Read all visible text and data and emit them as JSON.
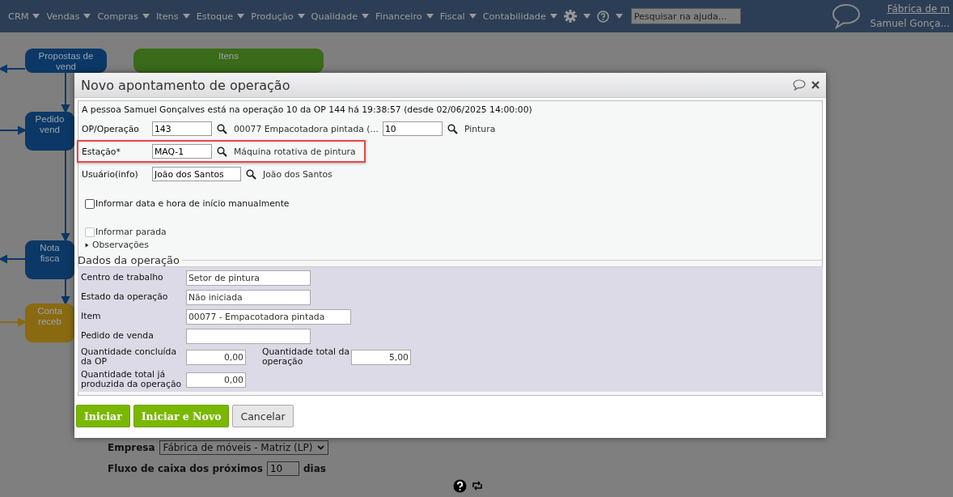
{
  "nav": {
    "menus": [
      "CRM",
      "Vendas",
      "Compras",
      "Itens",
      "Estoque",
      "Produção",
      "Qualidade",
      "Financeiro",
      "Fiscal",
      "Contabilidade"
    ],
    "search": {
      "placeholder": "Pesquisar na ajuda..."
    },
    "company_link": "Fábrica de m",
    "user": "Samuel Gonça..."
  },
  "flowchart": {
    "nodes": [
      {
        "lines": [
          "Propostas de",
          "vend"
        ],
        "color": "#0b3866"
      },
      {
        "lines": [
          "Itens"
        ],
        "color": "#3b6a1a"
      },
      {
        "lines": [
          "Pedido",
          "vend"
        ],
        "color": "#0b3866"
      },
      {
        "lines": [
          "Nota",
          "fisca"
        ],
        "color": "#0b3866"
      },
      {
        "lines": [
          "Conta",
          "receb"
        ],
        "color": "#8a6a10"
      }
    ]
  },
  "background_form": {
    "company_label": "Empresa",
    "company_select": "Fábrica de móveis - Matriz (LP)",
    "cashflow_label": "Fluxo de caixa dos próximos",
    "cashflow_days": "10",
    "days_unit": "dias"
  },
  "dialog": {
    "title": "Novo apontamento de operação",
    "info": "A pessoa Samuel Gonçalves está na operação 10 da OP 144 há 19:38:57 (desde 02/06/2025 14:00:00)",
    "fields": [
      {
        "label": "OP/Operação",
        "value": "143",
        "description": "00077 Empacotadora pintada (...",
        "second_value": "10",
        "second_description": "Pintura",
        "highlighted": false
      },
      {
        "label": "Estação*",
        "value": "MAQ-1",
        "description": "Máquina rotativa de pintura",
        "highlighted": true
      },
      {
        "label": "Usuário(info)",
        "value": "João dos Santos",
        "description": "João dos Santos",
        "highlighted": false
      }
    ],
    "checkboxes": [
      {
        "label": "Informar data e hora de início manualmente",
        "checked": false,
        "disabled": false
      },
      {
        "label": "Informar parada",
        "checked": false,
        "disabled": true
      }
    ],
    "expander": {
      "label": "Observações",
      "expanded": false
    },
    "section": {
      "title": "Dados da operação",
      "rows": [
        [
          {
            "label": "Centro de trabalho",
            "value": "Setor de pintura",
            "kind": "text"
          }
        ],
        [
          {
            "label": "Estado da operação",
            "value": "Não iniciada",
            "kind": "text"
          }
        ],
        [
          {
            "label": "Item",
            "value": "00077 - Empacotadora pintada",
            "kind": "wide"
          }
        ],
        [
          {
            "label": "Pedido de venda",
            "kind": "text"
          }
        ],
        [
          {
            "label": "Quantidade concluída da OP",
            "value": "0,00",
            "kind": "number"
          },
          {
            "label": "Quantidade total da operação",
            "value": "5,00",
            "kind": "number"
          }
        ],
        [
          {
            "label": "Quantidade total já produzida da operação",
            "value": "0,00",
            "kind": "number"
          }
        ]
      ]
    },
    "buttons": [
      {
        "label": "Iniciar",
        "kind": "primary"
      },
      {
        "label": "Iniciar e Novo",
        "kind": "primary"
      },
      {
        "label": "Cancelar",
        "kind": "secondary"
      }
    ]
  }
}
